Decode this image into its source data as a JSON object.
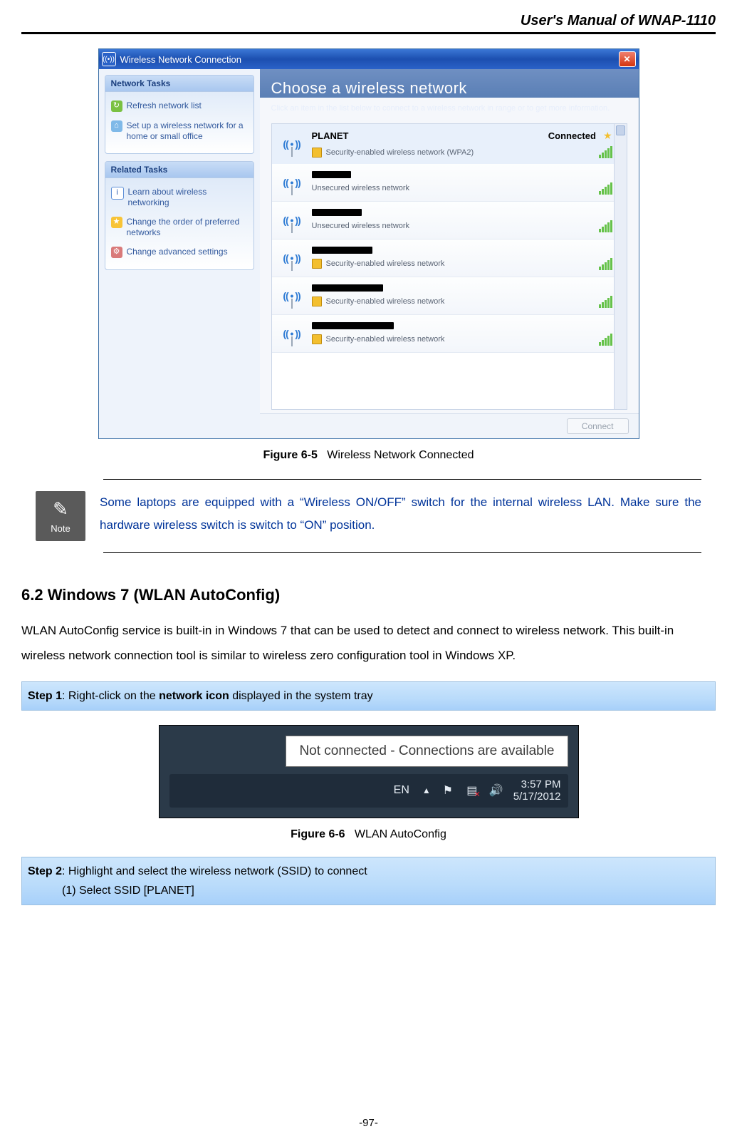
{
  "header": {
    "title": "User's Manual of WNAP-1110"
  },
  "figure65": {
    "window_title": "Wireless Network Connection",
    "side": {
      "tasks_title": "Network Tasks",
      "refresh": "Refresh network list",
      "setup": "Set up a wireless network for a home or small office",
      "related_title": "Related Tasks",
      "learn": "Learn about wireless networking",
      "order": "Change the order of preferred networks",
      "advanced": "Change advanced settings"
    },
    "main": {
      "heading": "Choose a wireless network",
      "sub": "Click an item in the list below to connect to a wireless network in range or to get more information.",
      "connect_btn": "Connect",
      "connected_label": "Connected",
      "networks": [
        {
          "ssid": "PLANET",
          "sec": "Security-enabled wireless network (WPA2)",
          "connected": true,
          "redacted": false,
          "lock": true
        },
        {
          "ssid": "████",
          "sec": "Unsecured wireless network",
          "connected": false,
          "redacted": true,
          "lock": false
        },
        {
          "ssid": "██████████",
          "sec": "Unsecured wireless network",
          "connected": false,
          "redacted": true,
          "lock": false
        },
        {
          "ssid": "████████████████",
          "sec": "Security-enabled wireless network",
          "connected": false,
          "redacted": true,
          "lock": true
        },
        {
          "ssid": "████████",
          "sec": "Security-enabled wireless network",
          "connected": false,
          "redacted": true,
          "lock": true
        },
        {
          "ssid": "████",
          "sec": "Security-enabled wireless network",
          "connected": false,
          "redacted": true,
          "lock": true
        }
      ]
    },
    "caption_bold": "Figure 6-5",
    "caption_text": "Wireless Network Connected"
  },
  "note": {
    "label": "Note",
    "text": "Some laptops are equipped with a “Wireless ON/OFF” switch for the internal wireless LAN. Make sure the hardware wireless switch is switch to “ON” position."
  },
  "section62": {
    "heading": "6.2  Windows 7 (WLAN AutoConfig)",
    "para": "WLAN AutoConfig service is built-in in Windows 7 that can be used to detect and connect to wireless network. This built-in wireless network connection tool is similar to wireless zero configuration tool in Windows XP."
  },
  "step1": {
    "label": "Step 1",
    "text_pre": ": Right-click on the ",
    "bold": "network icon",
    "text_post": " displayed in the system tray"
  },
  "figure66": {
    "tooltip": "Not connected - Connections are available",
    "lang": "EN",
    "time": "3:57 PM",
    "date": "5/17/2012",
    "caption_bold": "Figure 6-6",
    "caption_text": "WLAN AutoConfig"
  },
  "step2": {
    "label": "Step 2",
    "text": ": Highlight and select the wireless network (SSID) to connect",
    "sub1": "(1)  Select SSID [PLANET]"
  },
  "page_no": "-97-"
}
